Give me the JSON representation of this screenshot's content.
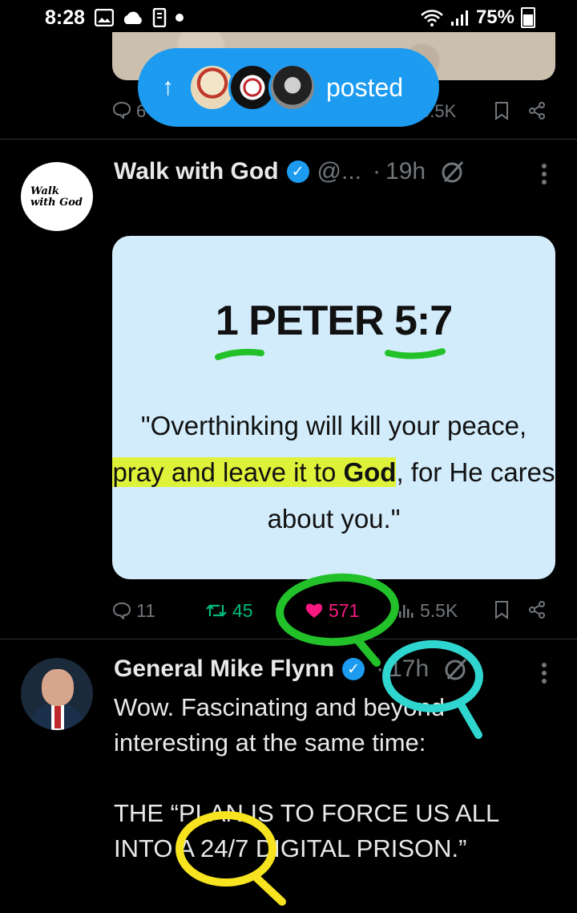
{
  "status_bar": {
    "time": "8:28",
    "battery": "75%"
  },
  "prev_tweet": {
    "reply_count": "6",
    "views": "5.5K"
  },
  "posted_pill": {
    "arrow": "↑",
    "label": "posted"
  },
  "tweet1": {
    "avatar_text": "Walk with God",
    "display_name": "Walk with God",
    "handle": "@...",
    "separator": "·",
    "time": "19h",
    "card": {
      "reference": "1 PETER 5:7",
      "quote_open": "\"Overthinking will kill your peace,",
      "quote_highlight_plain": "pray and leave it to ",
      "quote_highlight_bold": "God",
      "quote_rest": ", for He cares about you.\""
    },
    "actions": {
      "replies": "11",
      "reposts": "45",
      "likes": "571",
      "views": "5.5K"
    }
  },
  "tweet2": {
    "display_name": "General Mike Flynn",
    "separator": "·",
    "time": "17h",
    "text_line1": "Wow. Fascinating and beyond",
    "text_line2": "interesting at the same time:",
    "text_line3": "THE “PLAN IS TO FORCE US ALL",
    "text_line4": "INTO A 24/7 DIGITAL PRISON.”"
  },
  "colors": {
    "accent": "#1d9bf0",
    "like": "#f91880",
    "repost": "#00ba7c",
    "muted": "#71767b",
    "highlight": "#dff23a"
  }
}
